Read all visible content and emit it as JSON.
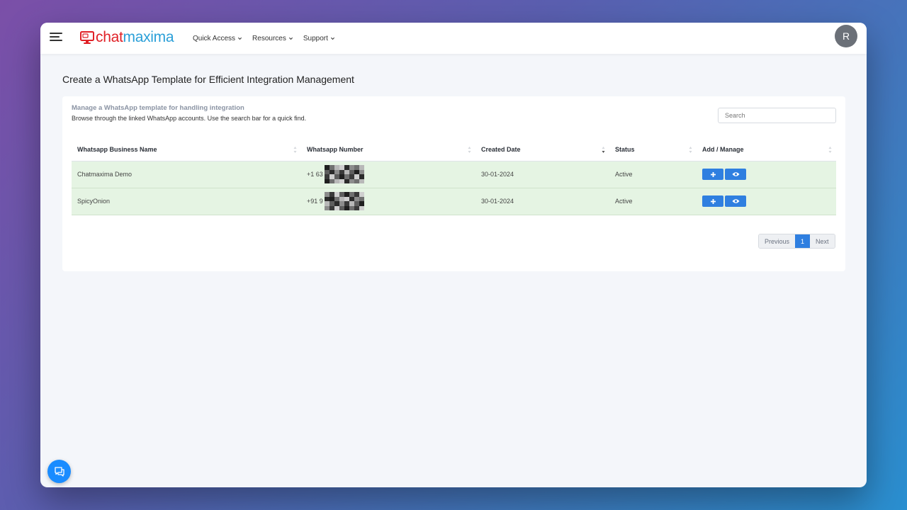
{
  "app": {
    "logo_chat": "chat",
    "logo_maxima": "maxima",
    "brand_colors": {
      "red": "#e02127",
      "blue": "#2a9fd8",
      "accent": "#2f7fe0"
    },
    "user_initial": "R"
  },
  "nav": [
    {
      "label": "Quick Access"
    },
    {
      "label": "Resources"
    },
    {
      "label": "Support"
    }
  ],
  "page": {
    "title": "Create a WhatsApp Template for Efficient Integration Management"
  },
  "card": {
    "subtitle": "Manage a WhatsApp template for handling integration",
    "description": "Browse through the linked WhatsApp accounts. Use the search bar for a quick find.",
    "search_placeholder": "Search"
  },
  "table": {
    "headers": [
      "Whatsapp Business Name",
      "Whatsapp Number",
      "Created Date",
      "Status",
      "Add / Manage"
    ],
    "rows": [
      {
        "name": "Chatmaxima Demo",
        "number_prefix": "+1 63",
        "created": "30-01-2024",
        "status": "Active"
      },
      {
        "name": "SpicyOnion",
        "number_prefix": "+91 9",
        "created": "30-01-2024",
        "status": "Active"
      }
    ],
    "row_actions": [
      "plus-icon",
      "eye-icon"
    ]
  },
  "pagination": {
    "previous": "Previous",
    "current": "1",
    "next": "Next"
  }
}
